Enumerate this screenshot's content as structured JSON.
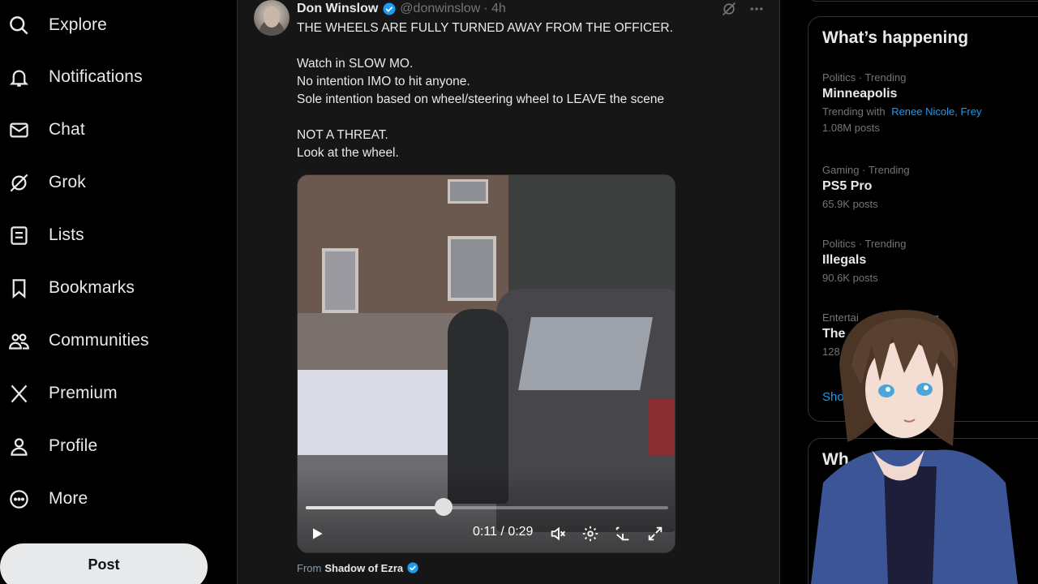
{
  "nav": {
    "items": [
      {
        "label": "Explore",
        "icon": "search-icon"
      },
      {
        "label": "Notifications",
        "icon": "bell-icon"
      },
      {
        "label": "Chat",
        "icon": "mail-icon"
      },
      {
        "label": "Grok",
        "icon": "grok-icon"
      },
      {
        "label": "Lists",
        "icon": "list-icon"
      },
      {
        "label": "Bookmarks",
        "icon": "bookmark-icon"
      },
      {
        "label": "Communities",
        "icon": "people-icon"
      },
      {
        "label": "Premium",
        "icon": "x-logo-icon"
      },
      {
        "label": "Profile",
        "icon": "person-icon"
      },
      {
        "label": "More",
        "icon": "more-circle-icon"
      }
    ],
    "post_label": "Post"
  },
  "tweet": {
    "author": "Don Winslow",
    "handle": "@donwinslow",
    "time": "· 4h",
    "lines": [
      "THE WHEELS ARE FULLY TURNED AWAY FROM THE OFFICER.",
      "",
      "Watch in SLOW MO.",
      "No intention IMO to hit anyone.",
      "Sole intention based on wheel/steering wheel to LEAVE the scene",
      "",
      "NOT A THREAT.",
      "Look at the wheel."
    ],
    "video": {
      "current_time": "0:11",
      "separator": "/",
      "duration": "0:29",
      "progress": 0.38
    },
    "from_label": "From",
    "from_source": "Shadow of Ezra"
  },
  "trends": {
    "title": "What’s happening",
    "items": [
      {
        "category": "Politics · Trending",
        "name": "Minneapolis",
        "with_prefix": "Trending with",
        "with_links": "Renee Nicole, Frey",
        "count": "1.08M posts"
      },
      {
        "category": "Gaming · Trending",
        "name": "PS5 Pro",
        "count": "65.9K posts"
      },
      {
        "category": "Politics · Trending",
        "name": "Illegals",
        "count": "90.6K posts"
      },
      {
        "category": "Entertai",
        "category_tail": "ending",
        "name": "The",
        "count": "128"
      }
    ],
    "show_more": "Sho",
    "second_title": "Wh"
  },
  "colors": {
    "accent": "#1d9bf0",
    "background": "#000000",
    "tweet_bg": "#161616",
    "text": "#e7e9ea",
    "muted": "#71767b"
  }
}
